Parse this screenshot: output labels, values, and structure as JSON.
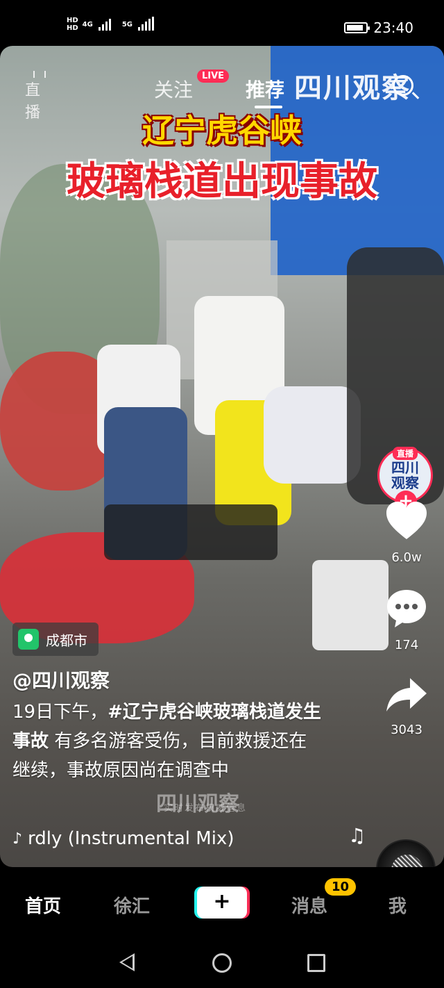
{
  "status_bar": {
    "hd1": "HD",
    "hd2": "HD",
    "net1": "4G",
    "net2": "5G",
    "time": "23:40",
    "battery_level": 0.9
  },
  "top_tabs": {
    "live_label": "直播",
    "follow": "关注",
    "live_badge": "LIVE",
    "recommend": "推荐"
  },
  "video": {
    "watermark_top": "四川观察",
    "headline_line1": "辽宁虎谷峡",
    "headline_line2": "玻璃栈道出现事故",
    "watermark_mid": "四川观察",
    "watermark_sub": "实时发布权威信息"
  },
  "rail": {
    "avatar_live": "直播",
    "avatar_line1": "四川",
    "avatar_line2": "观察",
    "likes": "6.0w",
    "comments": "174",
    "shares": "3043"
  },
  "info": {
    "location": "成都市",
    "author": "@四川观察",
    "caption_prefix": "19日下午，",
    "caption_hashtag": "#辽宁虎谷峡玻璃栈道发生事故",
    "caption_rest": " 有多名游客受伤，目前救援还在继续，事故原因尚在调查中",
    "music": "rdly (Instrumental Mix)"
  },
  "bottom_nav": {
    "home": "首页",
    "xuhui": "徐汇",
    "add": "+",
    "messages": "消息",
    "messages_badge": "10",
    "me": "我"
  },
  "colors": {
    "accent": "#fe2c55",
    "cyan": "#25f4ee",
    "badge": "#ffc300",
    "location_green": "#22c46a"
  },
  "icons": [
    "search-icon",
    "heart-icon",
    "comment-icon",
    "share-icon",
    "music-note-icon",
    "location-pin-icon",
    "back-icon",
    "home-icon",
    "recent-apps-icon"
  ]
}
